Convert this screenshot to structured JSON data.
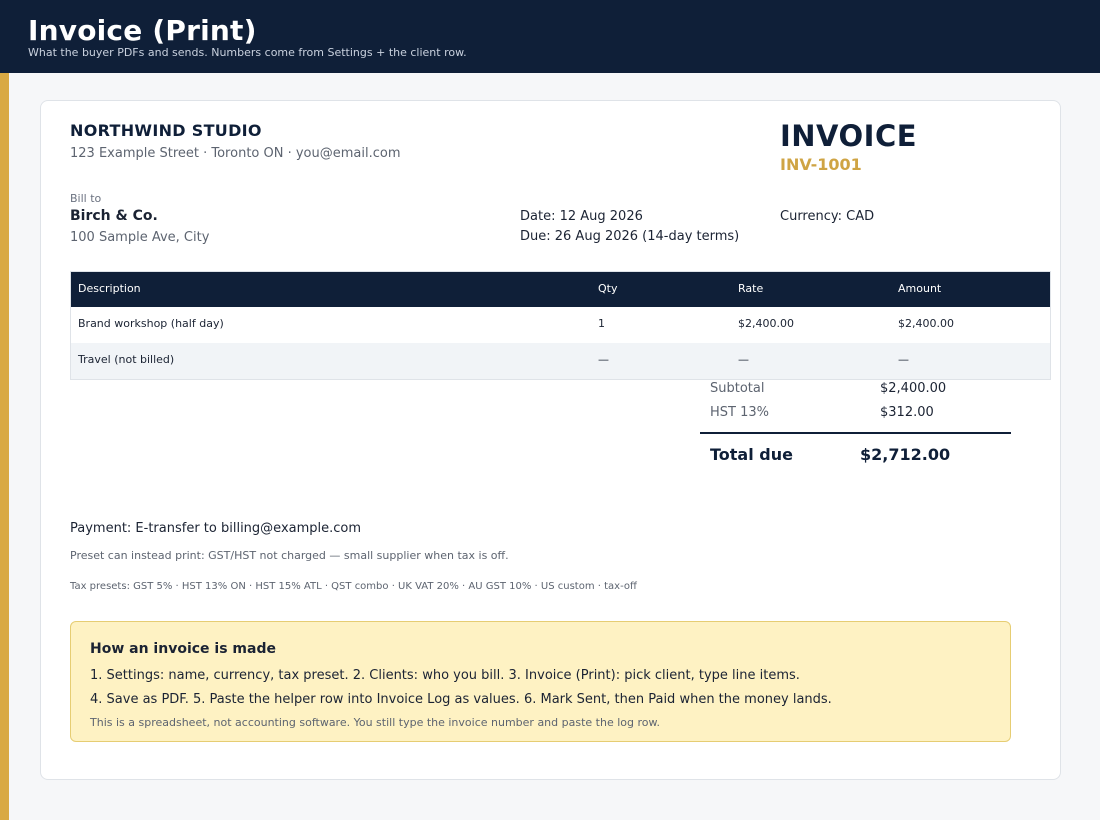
{
  "header": {
    "title": "Invoice (Print)",
    "subtitle": "What the buyer PDFs and sends. Numbers come from Settings + the client row."
  },
  "seller": {
    "name": "NORTHWIND STUDIO",
    "address_line": "123 Example Street  ·  Toronto ON  ·  you@email.com"
  },
  "invoice": {
    "word": "INVOICE",
    "number": "INV-1001",
    "date_line": "Date:  12 Aug 2026",
    "due_line": "Due:   26 Aug 2026  (14-day terms)",
    "currency_line": "Currency: CAD"
  },
  "bill_to": {
    "label": "Bill to",
    "name": "Birch & Co.",
    "address": "100 Sample Ave, City"
  },
  "items": {
    "columns": [
      "Description",
      "Qty",
      "Rate",
      "Amount"
    ],
    "rows": [
      [
        "Brand workshop (half day)",
        "1",
        "$2,400.00",
        "$2,400.00"
      ],
      [
        "Travel (not billed)",
        "—",
        "—",
        "—"
      ]
    ]
  },
  "totals": {
    "subtotal_label": "Subtotal",
    "subtotal_value": "$2,400.00",
    "tax_label": "HST 13%",
    "tax_value": "$312.00",
    "total_label": "Total due",
    "total_value": "$2,712.00"
  },
  "footer": {
    "payment": "Payment: E-transfer to billing@example.com",
    "preset_note": "Preset can instead print: GST/HST not charged — small supplier when tax is off.",
    "tax_presets": "Tax presets: GST 5%  ·  HST 13% ON  ·  HST 15% ATL  ·  QST combo  ·  UK VAT 20%  ·  AU GST 10%  ·  US custom  · tax-off"
  },
  "howto": {
    "title": "How an invoice is made",
    "line1": "1. Settings: name, currency, tax preset.   2. Clients: who you bill.   3. Invoice (Print): pick client, type line items.",
    "line2": "4. Save as PDF.   5. Paste the helper row into Invoice Log as values.   6. Mark Sent, then Paid when the money lands.",
    "note": "This is a spreadsheet, not accounting software. You still type the invoice number and paste the log row."
  },
  "colors": {
    "navy": "#0f1f38",
    "gold_accent": "#d9a943",
    "note_background": "#fef2c3"
  }
}
